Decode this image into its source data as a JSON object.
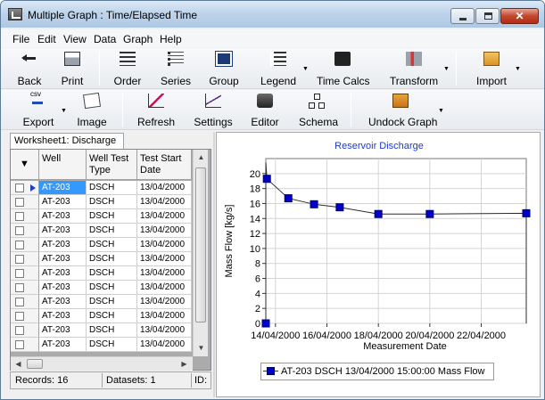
{
  "window": {
    "title": "Multiple Graph : Time/Elapsed Time"
  },
  "menu": [
    "File",
    "Edit",
    "View",
    "Data",
    "Graph",
    "Help"
  ],
  "toolbar1": {
    "back": "Back",
    "print": "Print",
    "order": "Order",
    "series": "Series",
    "group": "Group",
    "legend": "Legend",
    "time_calcs": "Time Calcs",
    "transform": "Transform",
    "import": "Import"
  },
  "toolbar2": {
    "export": "Export",
    "image": "Image",
    "refresh": "Refresh",
    "settings": "Settings",
    "editor": "Editor",
    "schema": "Schema",
    "undock": "Undock Graph"
  },
  "worksheet": {
    "tab": "Worksheet1: Discharge",
    "columns": [
      "Well",
      "Well Test Type",
      "Test Start Date"
    ],
    "rows": [
      [
        "AT-203",
        "DSCH",
        "13/04/2000"
      ],
      [
        "AT-203",
        "DSCH",
        "13/04/2000"
      ],
      [
        "AT-203",
        "DSCH",
        "13/04/2000"
      ],
      [
        "AT-203",
        "DSCH",
        "13/04/2000"
      ],
      [
        "AT-203",
        "DSCH",
        "13/04/2000"
      ],
      [
        "AT-203",
        "DSCH",
        "13/04/2000"
      ],
      [
        "AT-203",
        "DSCH",
        "13/04/2000"
      ],
      [
        "AT-203",
        "DSCH",
        "13/04/2000"
      ],
      [
        "AT-203",
        "DSCH",
        "13/04/2000"
      ],
      [
        "AT-203",
        "DSCH",
        "13/04/2000"
      ],
      [
        "AT-203",
        "DSCH",
        "13/04/2000"
      ],
      [
        "AT-203",
        "DSCH",
        "13/04/2000"
      ]
    ],
    "status": {
      "records": "Records: 16",
      "datasets": "Datasets: 1",
      "id": "ID:"
    }
  },
  "chart_data": {
    "type": "line",
    "title": "Reservoir Discharge",
    "xlabel": "Measurement Date",
    "ylabel": "Mass Flow [kg/s]",
    "ylim": [
      0,
      22
    ],
    "yticks": [
      0,
      2,
      4,
      6,
      8,
      10,
      12,
      14,
      16,
      18,
      20
    ],
    "xlim": [
      "2000-04-13 15:00",
      "2000-04-23 18:00"
    ],
    "xticks": [
      "14/04/2000",
      "16/04/2000",
      "18/04/2000",
      "20/04/2000",
      "22/04/2000"
    ],
    "xtick_dates": [
      "2000-04-14",
      "2000-04-16",
      "2000-04-18",
      "2000-04-20",
      "2000-04-22"
    ],
    "grid": true,
    "series": [
      {
        "name": "AT-203 DSCH 13/04/2000 15:00:00 Mass Flow",
        "color": "#0000cc",
        "points": [
          [
            "2000-04-13 15:00",
            0.0
          ],
          [
            "2000-04-13 15:00",
            21.5
          ],
          [
            "2000-04-13 16:00",
            19.3
          ],
          [
            "2000-04-14 12:00",
            16.7
          ],
          [
            "2000-04-15 12:00",
            15.9
          ],
          [
            "2000-04-16 12:00",
            15.5
          ],
          [
            "2000-04-18 00:00",
            14.6
          ],
          [
            "2000-04-20 00:00",
            14.6
          ],
          [
            "2000-04-23 18:00",
            14.7
          ],
          [
            "2000-04-23 18:00",
            0.0
          ]
        ],
        "markers": [
          [
            "2000-04-13 15:00",
            0.0
          ],
          [
            "2000-04-13 16:00",
            19.3
          ],
          [
            "2000-04-14 12:00",
            16.7
          ],
          [
            "2000-04-15 12:00",
            15.9
          ],
          [
            "2000-04-16 12:00",
            15.5
          ],
          [
            "2000-04-18 00:00",
            14.6
          ],
          [
            "2000-04-20 00:00",
            14.6
          ],
          [
            "2000-04-23 18:00",
            14.7
          ]
        ]
      }
    ],
    "legend_position": "bottom"
  }
}
